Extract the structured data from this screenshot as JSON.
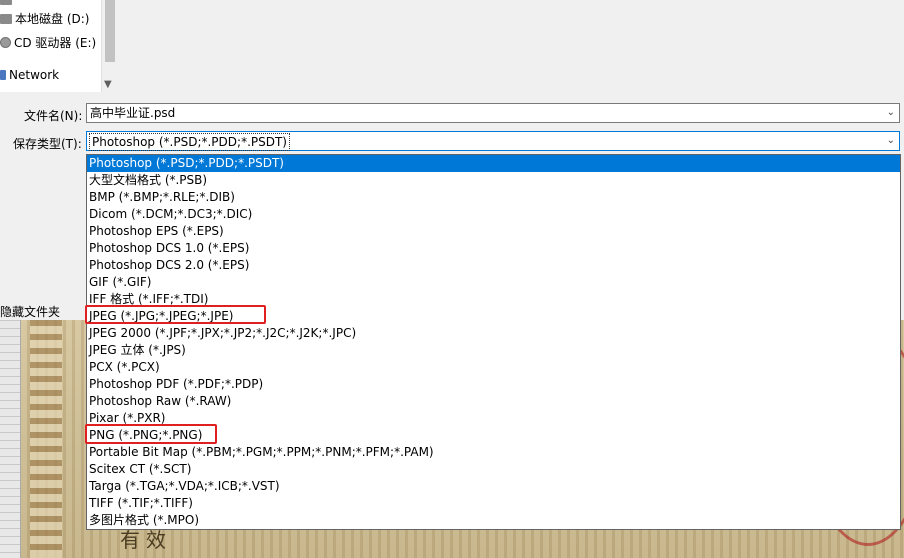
{
  "nav": {
    "items": [
      {
        "label": "本地磁盘 (D:)",
        "icon": "drive-icon"
      },
      {
        "label": "CD 驱动器 (E:)",
        "icon": "cd-drive-icon"
      },
      {
        "label": "Network",
        "icon": "network-icon"
      }
    ]
  },
  "form": {
    "filename_label": "文件名(N):",
    "filename_value": "高中毕业证.psd",
    "type_label": "保存类型(T):",
    "type_value": "Photoshop (*.PSD;*.PDD;*.PSDT)",
    "hide_folders_label": "隐藏文件夹"
  },
  "dropdown": {
    "selected_index": 0,
    "options": [
      "Photoshop (*.PSD;*.PDD;*.PSDT)",
      "大型文档格式 (*.PSB)",
      "BMP (*.BMP;*.RLE;*.DIB)",
      "Dicom (*.DCM;*.DC3;*.DIC)",
      "Photoshop EPS (*.EPS)",
      "Photoshop DCS 1.0 (*.EPS)",
      "Photoshop DCS 2.0 (*.EPS)",
      "GIF (*.GIF)",
      "IFF 格式 (*.IFF;*.TDI)",
      "JPEG (*.JPG;*.JPEG;*.JPE)",
      "JPEG 2000 (*.JPF;*.JPX;*.JP2;*.J2C;*.J2K;*.JPC)",
      "JPEG 立体 (*.JPS)",
      "PCX (*.PCX)",
      "Photoshop PDF (*.PDF;*.PDP)",
      "Photoshop Raw (*.RAW)",
      "Pixar (*.PXR)",
      "PNG (*.PNG;*.PNG)",
      "Portable Bit Map (*.PBM;*.PGM;*.PPM;*.PNM;*.PFM;*.PAM)",
      "Scitex CT (*.SCT)",
      "Targa (*.TGA;*.VDA;*.ICB;*.VST)",
      "TIFF (*.TIF;*.TIFF)",
      "多图片格式 (*.MPO)"
    ]
  },
  "background": {
    "text": "有效"
  },
  "colors": {
    "selection": "#0078d7",
    "highlight": "#e02020"
  }
}
